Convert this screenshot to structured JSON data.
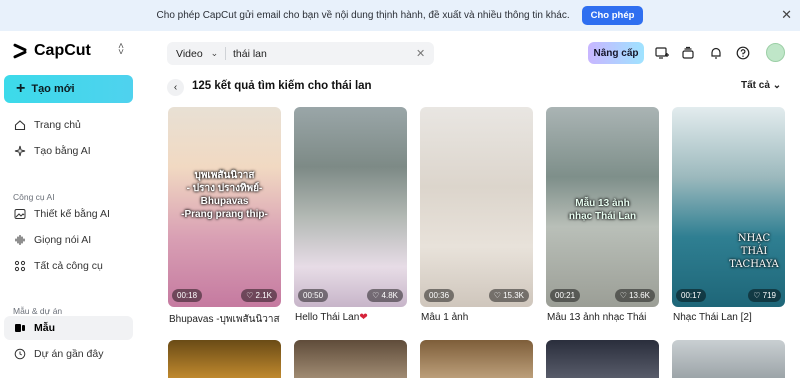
{
  "banner": {
    "message": "Cho phép CapCut gửi email cho bạn về nội dung thịnh hành, đề xuất và nhiều thông tin khác.",
    "button": "Cho phép",
    "close": "✕"
  },
  "sidebar": {
    "brand": "CapCut",
    "new_button": "Tạo mới",
    "items_top": [
      {
        "label": "Trang chủ",
        "icon": "home-icon"
      },
      {
        "label": "Tạo bằng AI",
        "icon": "sparkle-icon"
      }
    ],
    "section_tools": "Công cụ AI",
    "items_tools": [
      {
        "label": "Thiết kế bằng AI",
        "icon": "image-icon"
      },
      {
        "label": "Giọng nói AI",
        "icon": "waveform-icon"
      },
      {
        "label": "Tất cả công cụ",
        "icon": "grid-icon"
      }
    ],
    "section_projects": "Mẫu & dự án",
    "items_projects": [
      {
        "label": "Mẫu",
        "icon": "template-icon",
        "active": true
      },
      {
        "label": "Dự án gần đây",
        "icon": "clock-icon"
      }
    ]
  },
  "topbar": {
    "search_type": "Video",
    "search_query": "thái lan",
    "upgrade": "Nâng cấp"
  },
  "results": {
    "title": "125 kết quả tìm kiếm cho thái lan",
    "filter": "Tất cả"
  },
  "cards": [
    {
      "title": "Bhupavas -บุพเพสันนิวาส",
      "duration": "00:18",
      "likes": "2.1K",
      "overlay": "บุพเพสันนิวาส\n- ปราง ปรางทิพย์-\nBhupavas\n-Prang prang thip-"
    },
    {
      "title": "Hello Thái Lan",
      "duration": "00:50",
      "likes": "4.8K",
      "overlay": ""
    },
    {
      "title": "Mẫu 1 ảnh",
      "duration": "00:36",
      "likes": "15.3K",
      "overlay": ""
    },
    {
      "title": "Mẫu 13 ảnh nhạc Thái",
      "duration": "00:21",
      "likes": "13.6K",
      "overlay": "Mẫu 13 ảnh\nnhạc Thái Lan"
    },
    {
      "title": "Nhạc Thái Lan [2]",
      "duration": "00:17",
      "likes": "719",
      "overlay": "NHẠC THÁI\nTACHAYA"
    }
  ],
  "colors": {
    "accent": "#2f6ff0",
    "new_button": "#3cdaea",
    "banner_bg": "#e8f1fb"
  }
}
